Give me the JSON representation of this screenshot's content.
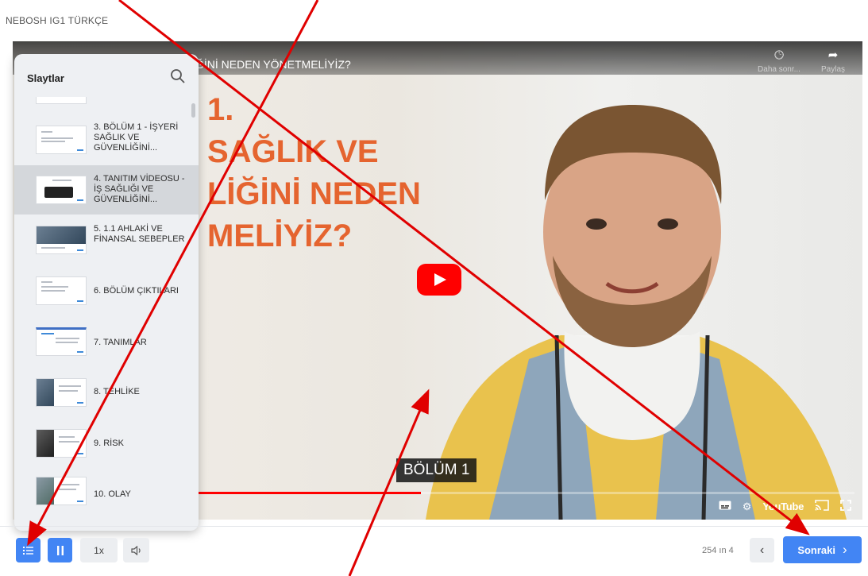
{
  "course": {
    "title": "NEBOSH IG1 TÜRKÇE"
  },
  "video": {
    "title": "ĞİNİ NEDEN YÖNETMELİYİZ?",
    "slide_text": "1.\nSAĞLIK VE\nLİĞİNİ NEDEN\nMELİYİZ?",
    "watch_later": "Daha sonr...",
    "share": "Paylaş",
    "subtitle": "BÖLÜM 1",
    "youtube_label": "YouTube",
    "progress": 0.48,
    "icons": [
      "clock-icon",
      "share-arrow-icon",
      "play-icon",
      "captions-icon",
      "settings-gear-icon",
      "cast-icon",
      "fullscreen-icon"
    ]
  },
  "slides_panel": {
    "title": "Slaytlar",
    "items": [
      {
        "label": "3. BÖLÜM 1 - İŞYERİ SAĞLIK VE GÜVENLİĞİNİ...",
        "active": false
      },
      {
        "label": "4. TANITIM VİDEOSU - İŞ SAĞLIĞI VE GÜVENLİĞİNİ...",
        "active": true
      },
      {
        "label": "5. 1.1 AHLAKİ VE FİNANSAL SEBEPLER",
        "active": false
      },
      {
        "label": "6. BÖLÜM ÇIKTILARI",
        "active": false
      },
      {
        "label": "7. TANIMLAR",
        "active": false
      },
      {
        "label": "8. TEHLİKE",
        "active": false
      },
      {
        "label": "9. RİSK",
        "active": false
      },
      {
        "label": "10. OLAY",
        "active": false
      }
    ]
  },
  "controls": {
    "speed_label": "1x",
    "page_count": "254 ın 4",
    "next_label": "Sonraki"
  },
  "colors": {
    "accent": "#4285f4",
    "slide_orange": "#e5642f",
    "annotation_red": "#e00000",
    "youtube_red": "#ff0000"
  }
}
